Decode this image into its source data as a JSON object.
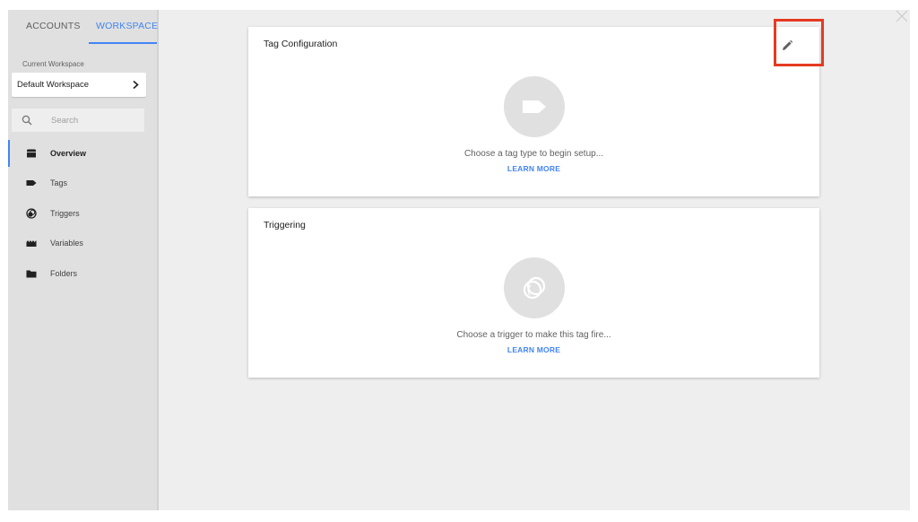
{
  "sidebar": {
    "tabs": [
      {
        "label": "ACCOUNTS"
      },
      {
        "label": "WORKSPACE"
      }
    ],
    "workspace": {
      "label": "Current Workspace",
      "name": "Default Workspace"
    },
    "search": {
      "placeholder": "Search"
    },
    "nav": [
      {
        "label": "Overview",
        "icon": "overview-icon",
        "active": true
      },
      {
        "label": "Tags",
        "icon": "tag-icon"
      },
      {
        "label": "Triggers",
        "icon": "trigger-icon"
      },
      {
        "label": "Variables",
        "icon": "variables-icon"
      },
      {
        "label": "Folders",
        "icon": "folder-icon"
      }
    ]
  },
  "tag_card": {
    "title": "Tag Configuration",
    "prompt": "Choose a tag type to begin setup...",
    "link": "LEARN MORE",
    "edit_icon": "pencil-icon"
  },
  "trigger_card": {
    "title": "Triggering",
    "prompt": "Choose a trigger to make this tag fire...",
    "link": "LEARN MORE"
  },
  "colors": {
    "accent": "#4285f4",
    "highlight": "#e53a22"
  }
}
